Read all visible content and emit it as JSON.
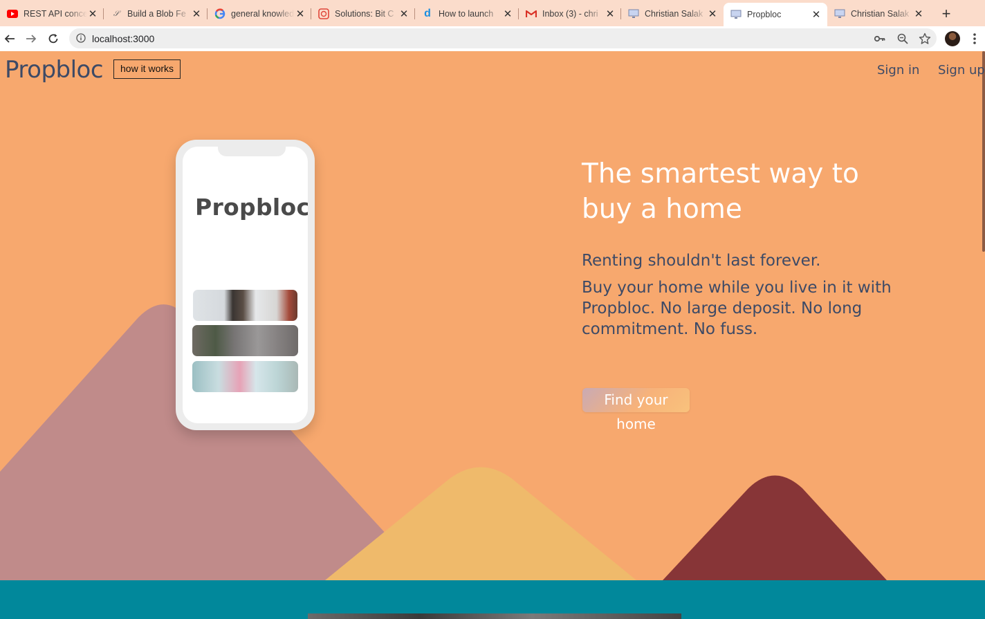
{
  "browser": {
    "tabs": [
      {
        "title": "REST API concepts",
        "favicon": "youtube-icon",
        "active": false
      },
      {
        "title": "Build a Blob Fe",
        "favicon": "blob-icon",
        "active": false
      },
      {
        "title": "general knowledge",
        "favicon": "google-icon",
        "active": false
      },
      {
        "title": "Solutions: Bit C",
        "favicon": "solutions-icon",
        "active": false
      },
      {
        "title": "How to launch",
        "favicon": "d-icon",
        "active": false
      },
      {
        "title": "Inbox (3) - chri",
        "favicon": "gmail-icon",
        "active": false
      },
      {
        "title": "Christian Salak",
        "favicon": "monitor-icon",
        "active": false
      },
      {
        "title": "Propbloc",
        "favicon": "monitor-icon",
        "active": true
      },
      {
        "title": "Christian Salak",
        "favicon": "monitor-icon",
        "active": false
      }
    ],
    "new_tab": "+",
    "close_glyph": "✕",
    "url": "localhost:3000",
    "colors": {
      "tabstrip": "#fbdccb",
      "toolbar": "#ffffff"
    }
  },
  "header": {
    "brand": "Propbloc",
    "how_it_works": "how it works",
    "sign_in": "Sign in",
    "sign_up": "Sign up"
  },
  "hero": {
    "headline": "The smartest way to buy a home",
    "subline1": "Renting shouldn't last forever.",
    "subline2": "Buy your home while you live in it with Propbloc. No large deposit. No long commitment. No fuss.",
    "cta": "Find your home",
    "phone_brand": "Propbloc"
  },
  "colors": {
    "background": "#f7a86e",
    "mountain_left": "#c08b8a",
    "mountain_middle": "#efba6b",
    "mountain_right": "#873537",
    "text_dark": "#3d4a66",
    "teal_band": "#01889b"
  }
}
